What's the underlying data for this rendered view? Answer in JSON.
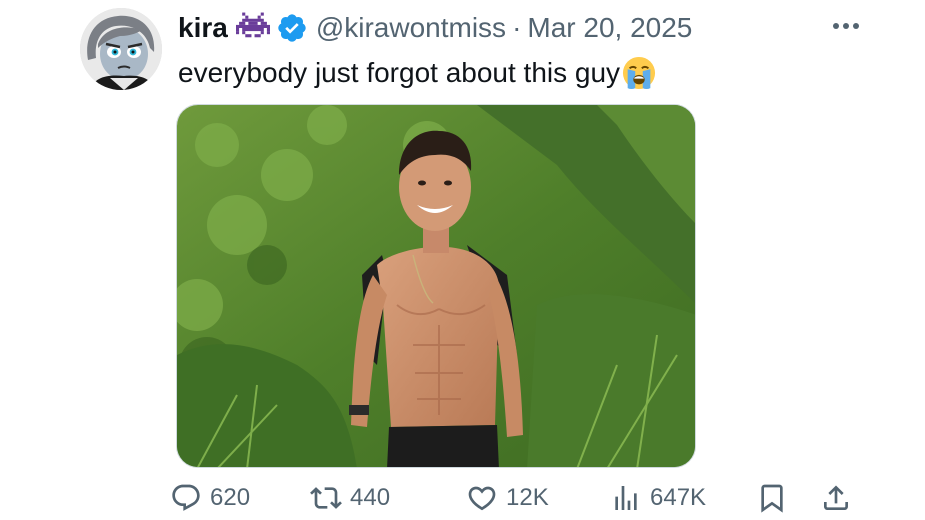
{
  "author": {
    "display_name": "kira",
    "name_emoji": "alien-monster-icon",
    "verified": true,
    "handle": "@kirawontmiss",
    "separator": "·",
    "date": "Mar 20, 2025"
  },
  "tweet": {
    "text": "everybody just forgot about this guy",
    "trailing_emoji": "loudly-crying-face-icon"
  },
  "menu": {
    "more_icon": "more-horizontal-icon"
  },
  "actions": {
    "replies": "620",
    "reposts": "440",
    "likes": "12K",
    "views": "647K"
  },
  "colors": {
    "text_primary": "#0f1419",
    "text_secondary": "#536471",
    "verified_blue": "#1d9bf0",
    "emoji_purple": "#6a3d9a"
  }
}
